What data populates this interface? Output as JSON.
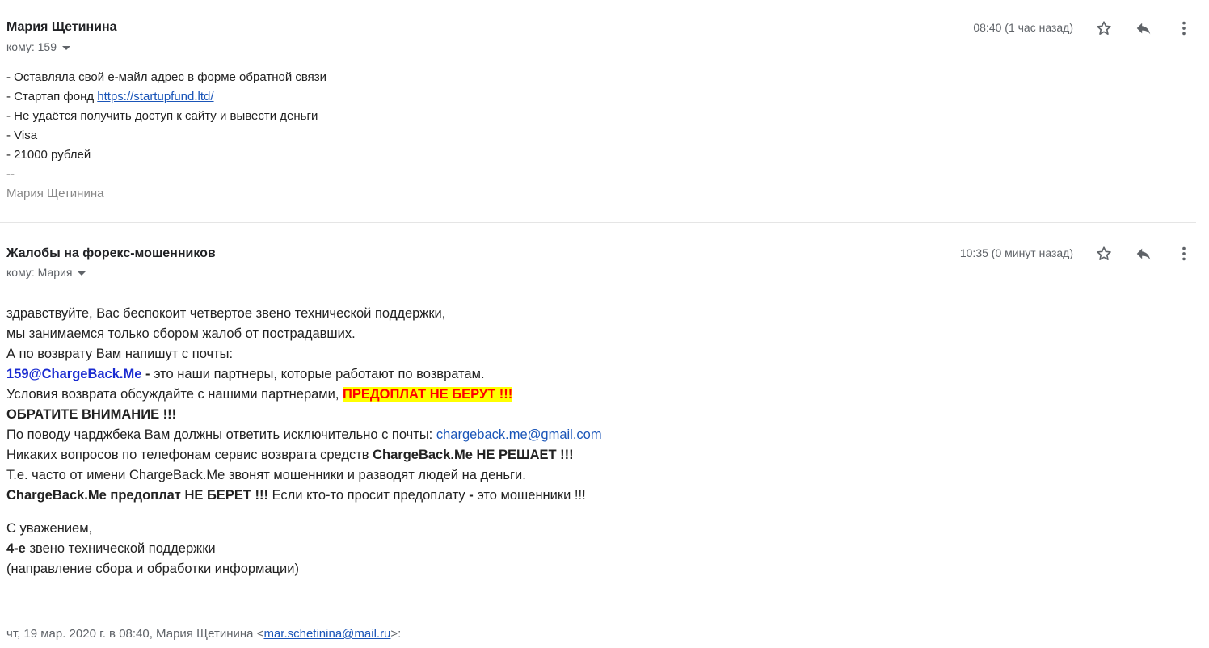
{
  "messages": [
    {
      "sender": "Мария Щетинина",
      "to_label": "кому: 159",
      "time": "08:40 (1 час назад)",
      "body": {
        "line1": "- Оставляла свой е-майл адрес в форме обратной связи",
        "line2_prefix": "- Стартап фонд ",
        "line2_link": "https://startupfund.ltd/",
        "line3": "- Не удаётся получить доступ к сайту и вывести деньги",
        "line4": "- Visa",
        "line5": "- 21000 рублей",
        "sig_sep": "--",
        "sig_name": "Мария Щетинина"
      }
    },
    {
      "sender": "Жалобы на форекс-мошенников",
      "to_label": "кому: Мария",
      "time": "10:35 (0 минут назад)",
      "body": {
        "l1": "здравствуйте, Вас беспокоит четвертое звено технической поддержки,",
        "l2": "мы занимаемся только сбором жалоб от пострадавших.",
        "l3": "А по возврату Вам напишут с почты:",
        "l4_email": "159@ChargeBack.Me",
        "l4_dash": " - ",
        "l4_rest": "это наши партнеры, которые работают по возвратам.",
        "l5_prefix": "Условия возврата обсуждайте с нашими партнерами, ",
        "l5_highlight": "ПРЕДОПЛАТ НЕ БЕРУТ !!!",
        "l6": "ОБРАТИТЕ ВНИМАНИЕ !!!",
        "l7_prefix": "По поводу чарджбека Вам должны ответить исключительно с почты: ",
        "l7_link": "chargeback.me@gmail.com",
        "l8_prefix": "Никаких вопросов по телефонам сервис возврата средств ",
        "l8_bold": "ChargeBack.Me НЕ РЕШАЕТ !!!",
        "l9": "Т.е. часто от имени ChargeBack.Me звонят мошенники и разводят людей на деньги.",
        "l10_bold": "ChargeBack.Me предоплат НЕ БЕРЕТ !!!",
        "l10_mid": " Если кто-то просит предоплату ",
        "l10_dash": "-",
        "l10_rest": " это мошенники !!!",
        "sig1": "С уважением,",
        "sig2_bold": "4-е",
        "sig2_rest": " звено технической поддержки",
        "sig3": "(направление сбора и обработки информации)"
      },
      "quote": {
        "prefix": "чт, 19 мар. 2020 г. в 08:40, Мария Щетинина <",
        "email": "mar.schetinina@mail.ru",
        "suffix": ">:"
      }
    }
  ],
  "icons": {
    "star": "star-icon",
    "reply": "reply-icon",
    "more": "more-vert-icon"
  },
  "colors": {
    "link": "#1a55b8",
    "email_highlight": "#1a2bd1",
    "warning_bg": "#ffff00",
    "warning_text": "#ff0000"
  }
}
